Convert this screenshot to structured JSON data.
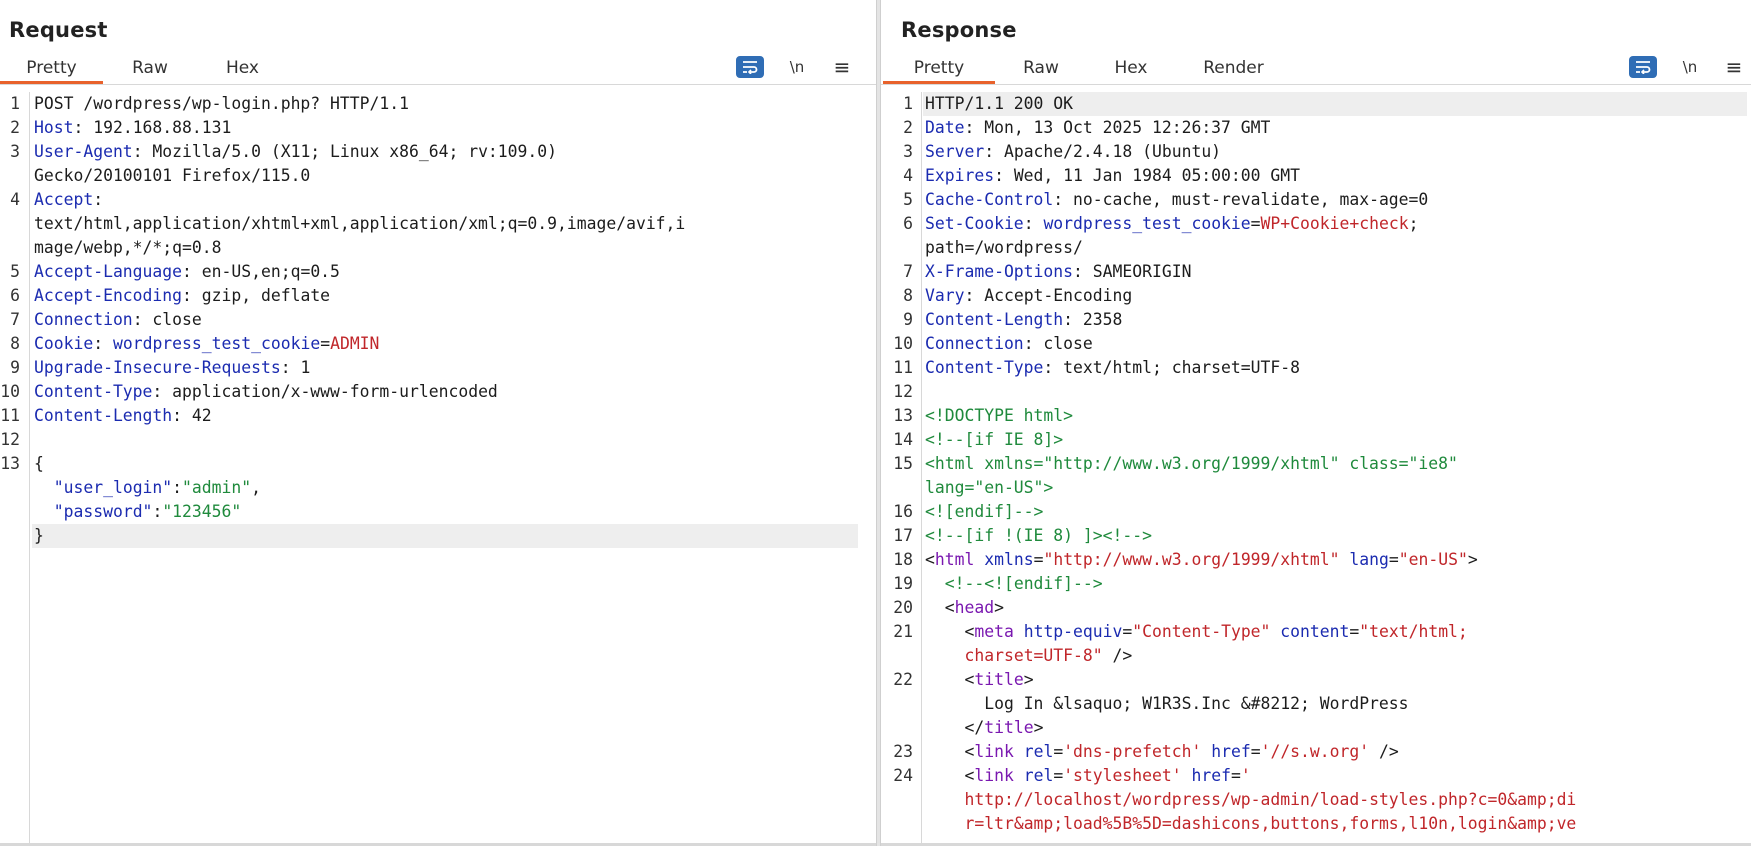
{
  "layout_buttons": [
    {
      "name": "side-by-side",
      "active": true
    },
    {
      "name": "top-bottom",
      "active": false
    },
    {
      "name": "single",
      "active": false
    }
  ],
  "request": {
    "title": "Request",
    "tabs": [
      "Pretty",
      "Raw",
      "Hex"
    ],
    "active_tab": "Pretty",
    "tools": {
      "newline": "\\n",
      "menu": "≡"
    },
    "lines": [
      {
        "n": "1",
        "segs": [
          [
            "v",
            "POST /wordpress/wp-login.php? HTTP/1.1"
          ]
        ]
      },
      {
        "n": "2",
        "segs": [
          [
            "k",
            "Host"
          ],
          [
            "v",
            ": 192.168.88.131"
          ]
        ]
      },
      {
        "n": "3",
        "segs": [
          [
            "k",
            "User-Agent"
          ],
          [
            "v",
            ": Mozilla/5.0 (X11; Linux x86_64; rv:109.0)"
          ]
        ]
      },
      {
        "n": "",
        "segs": [
          [
            "v",
            "Gecko/20100101 Firefox/115.0"
          ]
        ]
      },
      {
        "n": "4",
        "segs": [
          [
            "k",
            "Accept"
          ],
          [
            "v",
            ":"
          ]
        ]
      },
      {
        "n": "",
        "segs": [
          [
            "v",
            "text/html,application/xhtml+xml,application/xml;q=0.9,image/avif,i"
          ]
        ]
      },
      {
        "n": "",
        "segs": [
          [
            "v",
            "mage/webp,*/*;q=0.8"
          ]
        ]
      },
      {
        "n": "5",
        "segs": [
          [
            "k",
            "Accept-Language"
          ],
          [
            "v",
            ": en-US,en;q=0.5"
          ]
        ]
      },
      {
        "n": "6",
        "segs": [
          [
            "k",
            "Accept-Encoding"
          ],
          [
            "v",
            ": gzip, deflate"
          ]
        ]
      },
      {
        "n": "7",
        "segs": [
          [
            "k",
            "Connection"
          ],
          [
            "v",
            ": close"
          ]
        ]
      },
      {
        "n": "8",
        "segs": [
          [
            "k",
            "Cookie"
          ],
          [
            "v",
            ": "
          ],
          [
            "ck",
            "wordpress_test_cookie"
          ],
          [
            "v",
            "="
          ],
          [
            "cv",
            "ADMIN"
          ]
        ]
      },
      {
        "n": "9",
        "segs": [
          [
            "k",
            "Upgrade-Insecure-Requests"
          ],
          [
            "v",
            ": 1"
          ]
        ]
      },
      {
        "n": "10",
        "segs": [
          [
            "k",
            "Content-Type"
          ],
          [
            "v",
            ": application/x-www-form-urlencoded"
          ]
        ]
      },
      {
        "n": "11",
        "segs": [
          [
            "k",
            "Content-Length"
          ],
          [
            "v",
            ": 42"
          ]
        ]
      },
      {
        "n": "12",
        "segs": []
      },
      {
        "n": "13",
        "segs": [
          [
            "v",
            "{"
          ]
        ]
      },
      {
        "n": "",
        "segs": [
          [
            "v",
            "  "
          ],
          [
            "jk",
            "\"user_login\""
          ],
          [
            "v",
            ":"
          ],
          [
            "js",
            "\"admin\""
          ],
          [
            "v",
            ","
          ]
        ]
      },
      {
        "n": "",
        "segs": [
          [
            "v",
            "  "
          ],
          [
            "jk",
            "\"password\""
          ],
          [
            "v",
            ":"
          ],
          [
            "js",
            "\"123456\""
          ]
        ]
      },
      {
        "n": "",
        "segs": [
          [
            "v",
            "}"
          ]
        ],
        "hl": true
      }
    ]
  },
  "response": {
    "title": "Response",
    "tabs": [
      "Pretty",
      "Raw",
      "Hex",
      "Render"
    ],
    "active_tab": "Pretty",
    "tools": {
      "newline": "\\n",
      "menu": "≡"
    },
    "lines": [
      {
        "n": "1",
        "segs": [
          [
            "v",
            "HTTP/1.1 200 OK"
          ]
        ],
        "hl": true
      },
      {
        "n": "2",
        "segs": [
          [
            "k",
            "Date"
          ],
          [
            "v",
            ": Mon, 13 Oct 2025 12:26:37 GMT"
          ]
        ]
      },
      {
        "n": "3",
        "segs": [
          [
            "k",
            "Server"
          ],
          [
            "v",
            ": Apache/2.4.18 (Ubuntu)"
          ]
        ]
      },
      {
        "n": "4",
        "segs": [
          [
            "k",
            "Expires"
          ],
          [
            "v",
            ": Wed, 11 Jan 1984 05:00:00 GMT"
          ]
        ]
      },
      {
        "n": "5",
        "segs": [
          [
            "k",
            "Cache-Control"
          ],
          [
            "v",
            ": no-cache, must-revalidate, max-age=0"
          ]
        ]
      },
      {
        "n": "6",
        "segs": [
          [
            "k",
            "Set-Cookie"
          ],
          [
            "v",
            ": "
          ],
          [
            "ck",
            "wordpress_test_cookie"
          ],
          [
            "v",
            "="
          ],
          [
            "cv",
            "WP+Cookie+check"
          ],
          [
            "v",
            ";"
          ]
        ]
      },
      {
        "n": "",
        "segs": [
          [
            "v",
            "path=/wordpress/"
          ]
        ]
      },
      {
        "n": "7",
        "segs": [
          [
            "k",
            "X-Frame-Options"
          ],
          [
            "v",
            ": SAMEORIGIN"
          ]
        ]
      },
      {
        "n": "8",
        "segs": [
          [
            "k",
            "Vary"
          ],
          [
            "v",
            ": Accept-Encoding"
          ]
        ]
      },
      {
        "n": "9",
        "segs": [
          [
            "k",
            "Content-Length"
          ],
          [
            "v",
            ": 2358"
          ]
        ]
      },
      {
        "n": "10",
        "segs": [
          [
            "k",
            "Connection"
          ],
          [
            "v",
            ": close"
          ]
        ]
      },
      {
        "n": "11",
        "segs": [
          [
            "k",
            "Content-Type"
          ],
          [
            "v",
            ": text/html; charset=UTF-8"
          ]
        ]
      },
      {
        "n": "12",
        "segs": []
      },
      {
        "n": "13",
        "segs": [
          [
            "cmt",
            "<!DOCTYPE html>"
          ]
        ]
      },
      {
        "n": "14",
        "segs": [
          [
            "cmt",
            "<!--[if IE 8]>"
          ]
        ]
      },
      {
        "n": "15",
        "segs": [
          [
            "cmt",
            "<html xmlns=\"http://www.w3.org/1999/xhtml\" class=\"ie8\""
          ]
        ]
      },
      {
        "n": "",
        "segs": [
          [
            "cmt",
            "lang=\"en-US\">"
          ]
        ]
      },
      {
        "n": "16",
        "segs": [
          [
            "cmt",
            "<![endif]-->"
          ]
        ]
      },
      {
        "n": "17",
        "segs": [
          [
            "cmt",
            "<!--[if !(IE 8) ]><!-->"
          ]
        ]
      },
      {
        "n": "18",
        "segs": [
          [
            "punct",
            "<"
          ],
          [
            "tag",
            "html"
          ],
          [
            "v",
            " "
          ],
          [
            "att",
            "xmlns"
          ],
          [
            "v",
            "="
          ],
          [
            "str",
            "\"http://www.w3.org/1999/xhtml\""
          ],
          [
            "v",
            " "
          ],
          [
            "att",
            "lang"
          ],
          [
            "v",
            "="
          ],
          [
            "str",
            "\"en-US\""
          ],
          [
            "punct",
            ">"
          ]
        ]
      },
      {
        "n": "19",
        "segs": [
          [
            "v",
            "  "
          ],
          [
            "cmt",
            "<!--<![endif]-->"
          ]
        ]
      },
      {
        "n": "20",
        "segs": [
          [
            "v",
            "  <"
          ],
          [
            "tag",
            "head"
          ],
          [
            "punct",
            ">"
          ]
        ]
      },
      {
        "n": "21",
        "segs": [
          [
            "v",
            "    <"
          ],
          [
            "tag",
            "meta"
          ],
          [
            "v",
            " "
          ],
          [
            "att",
            "http-equiv"
          ],
          [
            "v",
            "="
          ],
          [
            "str",
            "\"Content-Type\""
          ],
          [
            "v",
            " "
          ],
          [
            "att",
            "content"
          ],
          [
            "v",
            "="
          ],
          [
            "str",
            "\"text/html;"
          ]
        ]
      },
      {
        "n": "",
        "segs": [
          [
            "v",
            "    "
          ],
          [
            "str",
            "charset=UTF-8\""
          ],
          [
            "v",
            " />"
          ]
        ]
      },
      {
        "n": "22",
        "segs": [
          [
            "v",
            "    <"
          ],
          [
            "tag",
            "title"
          ],
          [
            "punct",
            ">"
          ]
        ]
      },
      {
        "n": "",
        "segs": [
          [
            "v",
            "      Log In &lsaquo; W1R3S.Inc &#8212; WordPress"
          ]
        ]
      },
      {
        "n": "",
        "segs": [
          [
            "v",
            "    </"
          ],
          [
            "tag",
            "title"
          ],
          [
            "punct",
            ">"
          ]
        ]
      },
      {
        "n": "23",
        "segs": [
          [
            "v",
            "    <"
          ],
          [
            "tag",
            "link"
          ],
          [
            "v",
            " "
          ],
          [
            "att",
            "rel"
          ],
          [
            "v",
            "="
          ],
          [
            "str",
            "'dns-prefetch'"
          ],
          [
            "v",
            " "
          ],
          [
            "att",
            "href"
          ],
          [
            "v",
            "="
          ],
          [
            "str",
            "'//s.w.org'"
          ],
          [
            "v",
            " />"
          ]
        ]
      },
      {
        "n": "24",
        "segs": [
          [
            "v",
            "    <"
          ],
          [
            "tag",
            "link"
          ],
          [
            "v",
            " "
          ],
          [
            "att",
            "rel"
          ],
          [
            "v",
            "="
          ],
          [
            "str",
            "'stylesheet'"
          ],
          [
            "v",
            " "
          ],
          [
            "att",
            "href"
          ],
          [
            "v",
            "="
          ],
          [
            "str",
            "'"
          ]
        ]
      },
      {
        "n": "",
        "segs": [
          [
            "v",
            "    "
          ],
          [
            "str",
            "http://localhost/wordpress/wp-admin/load-styles.php?c=0&amp;di"
          ]
        ]
      },
      {
        "n": "",
        "segs": [
          [
            "v",
            "    "
          ],
          [
            "str",
            "r=ltr&amp;load%5B%5D=dashicons,buttons,forms,l10n,login&amp;ve"
          ]
        ]
      }
    ]
  }
}
